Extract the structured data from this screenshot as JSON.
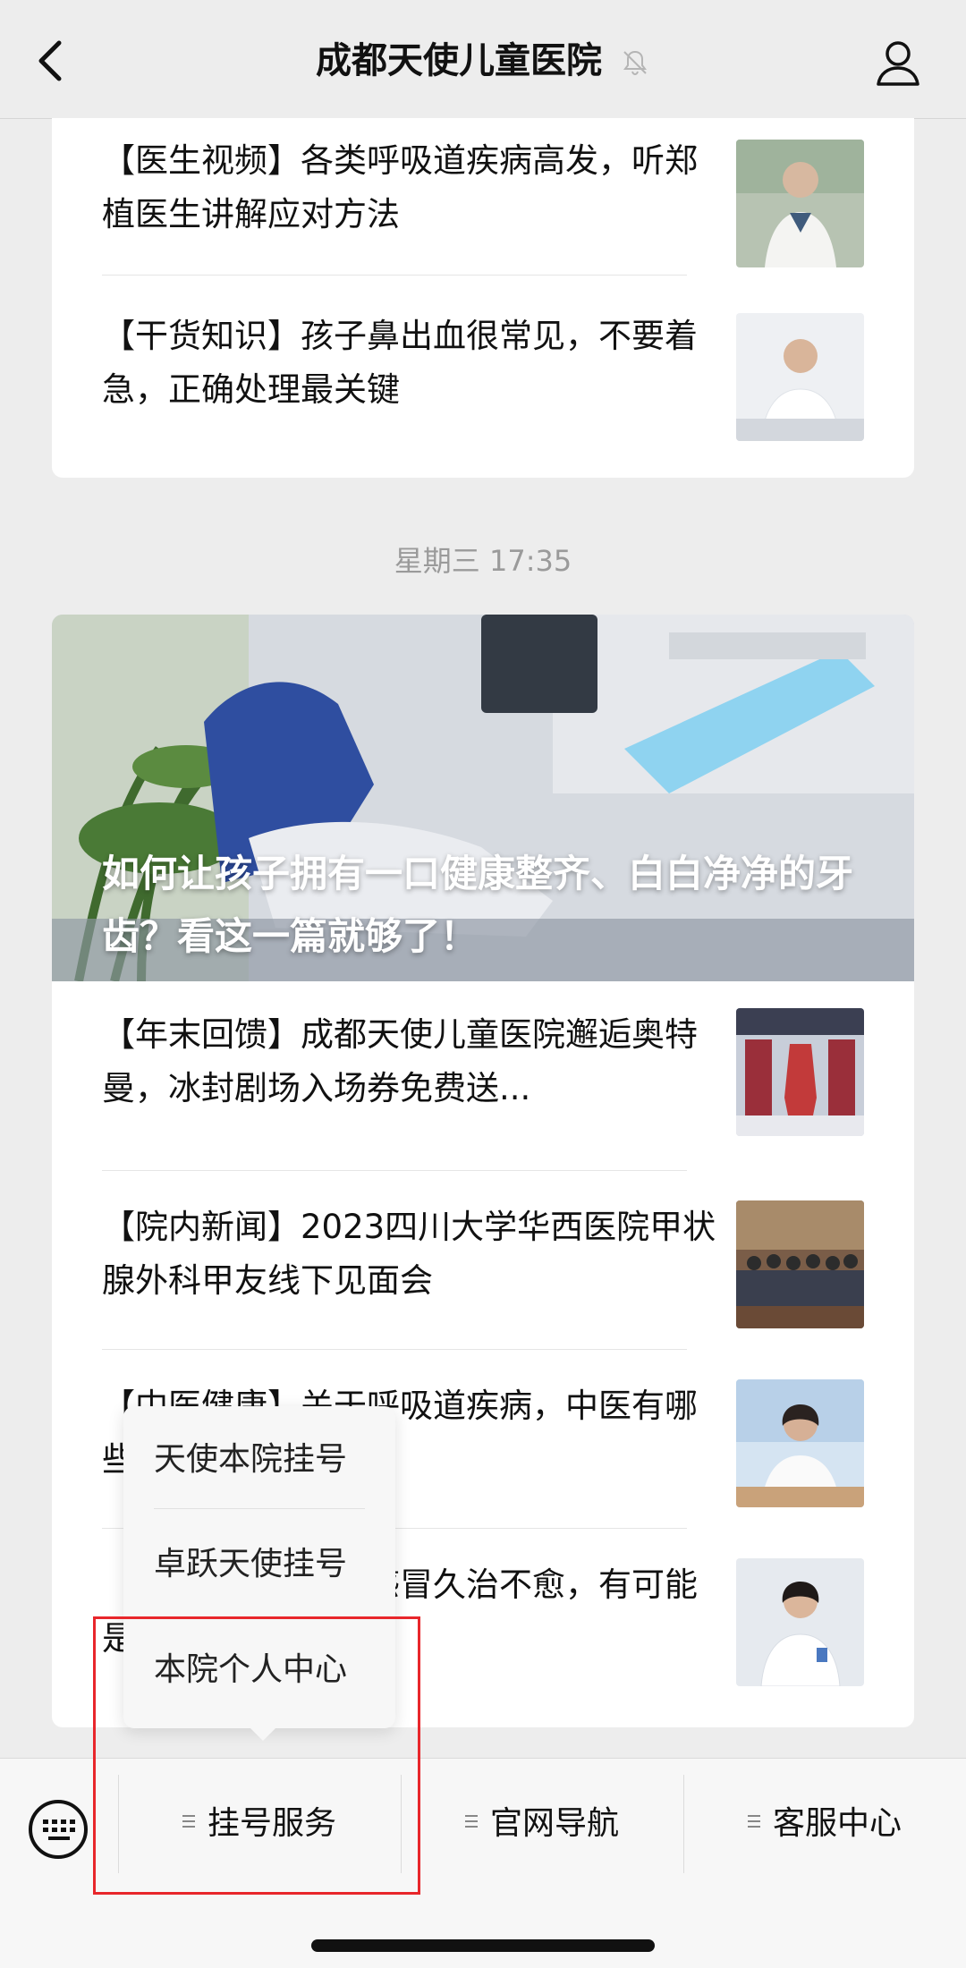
{
  "header": {
    "title": "成都天使儿童医院",
    "back_icon": "chevron-left-icon",
    "profile_icon": "user-icon",
    "mute_icon": "bell-off-icon"
  },
  "top_card": {
    "items": [
      {
        "text": "【医生视频】各类呼吸道疾病高发，听郑植医生讲解应对方法"
      },
      {
        "text": "【干货知识】孩子鼻出血很常见，不要着急，正确处理最关键"
      }
    ]
  },
  "timestamp": "星期三 17:35",
  "main_card": {
    "hero_title": "如何让孩子拥有一口健康整齐、白白净净的牙齿？看这一篇就够了！",
    "items": [
      {
        "text": "【年末回馈】成都天使儿童医院邂逅奥特曼，冰封剧场入场券免费送..."
      },
      {
        "text": "【院内新闻】2023四川大学华西医院甲状腺外科甲友线下见面会"
      },
      {
        "text": "【中医健康】关于呼吸道疾病，中医有哪些预防和养护建议？"
      },
      {
        "text": "【健康科普】孩子感冒久治不愈，有可能是鼻窦炎"
      }
    ]
  },
  "popup_menu": {
    "items": [
      "天使本院挂号",
      "卓跃天使挂号",
      "本院个人中心"
    ]
  },
  "bottom_bar": {
    "keyboard_icon": "keyboard-icon",
    "tabs": [
      "挂号服务",
      "官网导航",
      "客服中心"
    ]
  },
  "colors": {
    "highlight": "#e8262b",
    "background": "#ededed"
  }
}
